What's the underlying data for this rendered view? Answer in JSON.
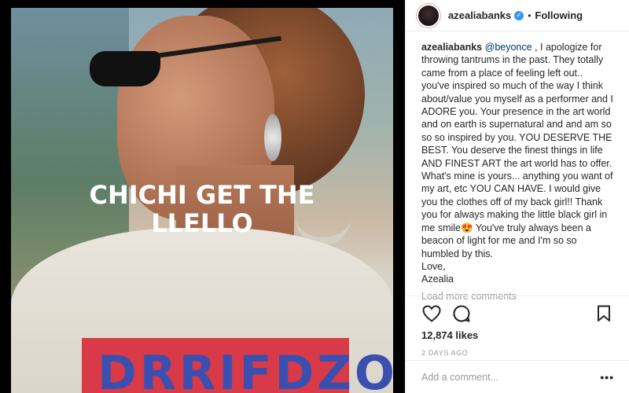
{
  "post": {
    "overlay_line1": "CHICHI GET THE",
    "overlay_line2": "LLELLO",
    "shirt_print": "DRRIFDZO"
  },
  "header": {
    "username": "azealiabanks",
    "verified_glyph": "✓",
    "separator": "•",
    "follow_status": "Following"
  },
  "caption": {
    "username": "azealiabanks",
    "mention": "@beyonce",
    "text": " , I apologize for throwing tantrums in the past. They totally came from a place of feeling left out.. you've inspired so much of the way I think about/value you myself as a performer and I ADORE you. Your presence in the art world and on earth is supernatural and and am so so so inspired by you. YOU DESERVE THE BEST. You deserve the finest things in life AND FINEST ART the art world has to offer. What's mine is yours... anything you want of my art, etc YOU CAN HAVE. I would give you the clothes off of my back girl!! Thank you for always making the little black girl in me smile😍 You've truly always been a beacon of light for me and I'm so so humbled by this.\nLove,\nAzealia"
  },
  "load_more": "Load more comments",
  "actions": {
    "like_icon": "heart-icon",
    "comment_icon": "comment-icon",
    "save_icon": "bookmark-icon"
  },
  "likes": "12,874 likes",
  "date": "2 DAYS AGO",
  "comment": {
    "placeholder": "Add a comment...",
    "more": "•••"
  },
  "colors": {
    "link": "#003569",
    "verified": "#3897f0",
    "muted": "#999999",
    "text": "#262626"
  }
}
